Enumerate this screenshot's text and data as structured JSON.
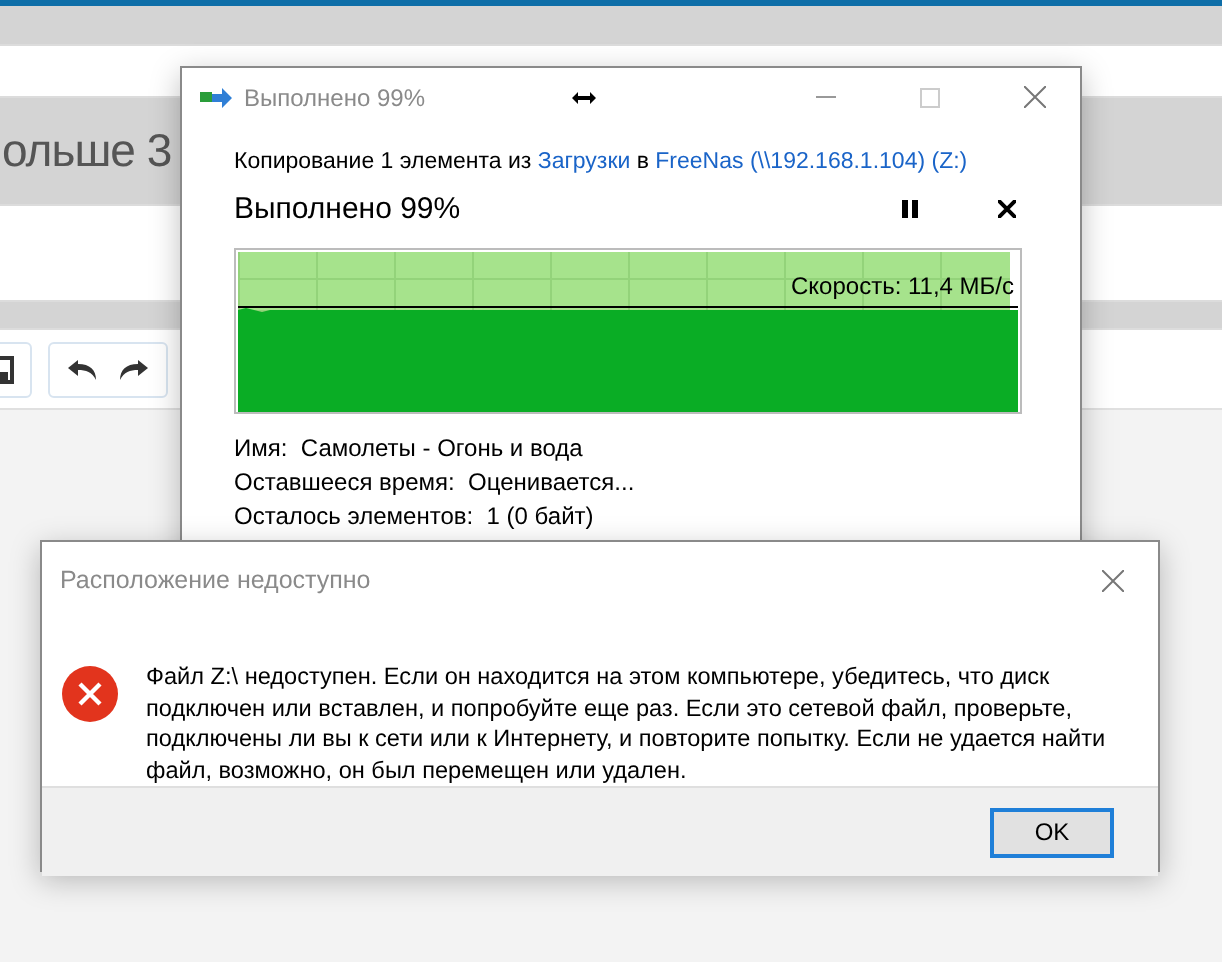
{
  "background_app": {
    "heading_fragment": "ольше 3"
  },
  "copy_dialog": {
    "title": "Выполнено 99%",
    "summary": [
      {
        "text": "Копирование 1 элемента из ",
        "kind": "plain"
      },
      {
        "text": "Загрузки",
        "kind": "link"
      },
      {
        "text": " в ",
        "kind": "plain"
      },
      {
        "text": "FreeNas (\\\\192.168.1.104) (Z:)",
        "kind": "link"
      }
    ],
    "progress_heading": "Выполнено 99%",
    "level": 0.99,
    "speed": "Скорость: 11,4 МБ/с",
    "details": [
      {
        "label": "Имя:",
        "value": "Самолеты - Огонь и вода"
      },
      {
        "label": "Оставшееся время:",
        "value": "Оценивается..."
      },
      {
        "label": "Осталось элементов:",
        "value": "1 (0 байт)"
      }
    ]
  },
  "error_dialog": {
    "title": "Расположение недоступно",
    "message": "Файл Z:\\ недоступен. Если он находится на этом компьютере, убедитесь, что диск подключен или вставлен, и попробуйте еще раз. Если это сетевой файл, проверьте, подключены ли вы к сети или к Интернету, и повторите попытку. Если не удается найти файл, возможно, он был перемещен или удален.",
    "buttons": [
      "OK"
    ]
  }
}
